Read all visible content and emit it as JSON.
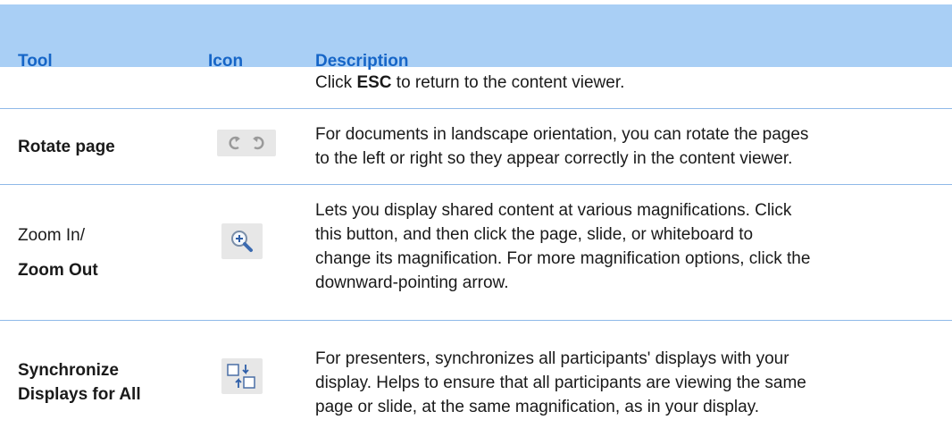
{
  "header": {
    "tool": "Tool",
    "icon": "Icon",
    "description": "Description"
  },
  "rows": [
    {
      "desc_prefix": "Click ",
      "desc_key": "ESC",
      "desc_suffix": " to return to the content viewer."
    },
    {
      "tool": "Rotate page",
      "icons": [
        "rotate-left-icon",
        "rotate-right-icon"
      ],
      "desc": [
        "For documents in landscape orientation, you can rotate the pages",
        "to the left or right so they appear correctly in the content viewer."
      ]
    },
    {
      "tool_line1": "Zoom In/",
      "tool_line2": "Zoom Out",
      "icons": [
        "zoom-in-icon"
      ],
      "desc": [
        "Lets you display shared content at various magnifications. Click",
        "this button, and then click the page, slide, or whiteboard to",
        "change its magnification. For more magnification options, click the",
        "downward-pointing arrow."
      ]
    },
    {
      "tool_line1": "Synchronize",
      "tool_line2": "Displays for All",
      "icons": [
        "synchronize-icon"
      ],
      "desc": [
        "For presenters, synchronizes all participants' displays with your",
        "display. Helps to ensure that all participants are viewing the same",
        "page or slide, at the same magnification, as in your display."
      ]
    }
  ],
  "colors": {
    "header_bg": "#a9cff5",
    "header_text": "#1565c7",
    "separator": "#8fb9e8"
  }
}
